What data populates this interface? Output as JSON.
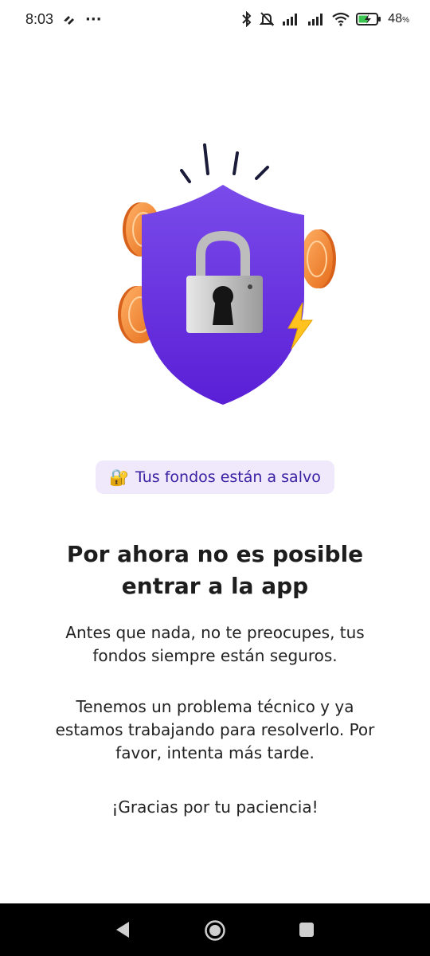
{
  "status_bar": {
    "time": "8:03",
    "overflow": "···",
    "battery_percent": "48",
    "battery_unit": "%",
    "icons": [
      "cloud-sync-icon",
      "bluetooth-icon",
      "mute-icon",
      "signal-icon",
      "signal-icon",
      "wifi-icon",
      "battery-charging-icon"
    ]
  },
  "hero": {
    "icon": "shield-lock-illustration"
  },
  "badge": {
    "emoji": "🔐",
    "text": "Tus fondos están a salvo"
  },
  "title": {
    "line1": "Por ahora no es posible",
    "line2": "entrar a la app"
  },
  "paragraphs": {
    "p1_line1": "Antes que nada, no te preocupes, tus",
    "p1_line2": "fondos siempre están seguros.",
    "p2_line1": "Tenemos un problema técnico y ya",
    "p2_line2": "estamos trabajando para resolverlo. Por",
    "p2_line3": "favor, intenta más tarde.",
    "p3": "¡Gracias por tu paciencia!"
  },
  "colors": {
    "shield": "#6a34e0",
    "badge_bg": "#efe9fb",
    "badge_text": "#3a1fa3",
    "coin": "#f08a2c",
    "nav_bg": "#000000"
  },
  "nav": {
    "back": "back-icon",
    "home": "home-icon",
    "recents": "recents-icon"
  }
}
